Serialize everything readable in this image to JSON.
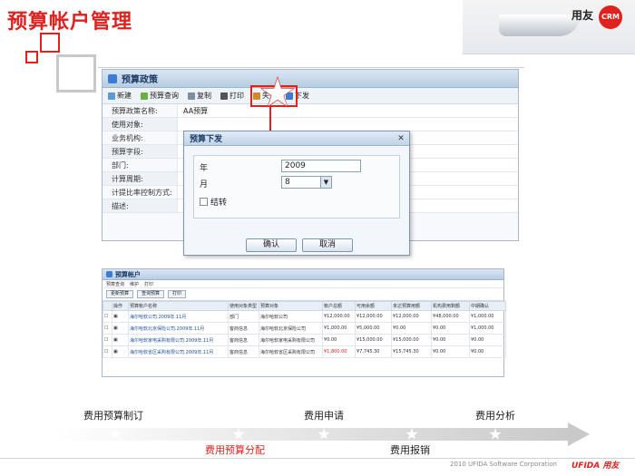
{
  "slide": {
    "title": "预算帐户管理",
    "brand_name": "用友",
    "brand_badge": "CRM",
    "copyright": "2010 UFIDA Software Corporation",
    "footer_logo": "UFIDA 用友",
    "accent_color": "#e0211d"
  },
  "main_window": {
    "title": "预算政策",
    "toolbar": [
      {
        "label": "新建",
        "icon": "new-icon"
      },
      {
        "label": "预算查询",
        "icon": "query-icon"
      },
      {
        "label": "复制",
        "icon": "copy-icon"
      },
      {
        "label": "打印",
        "icon": "print-icon"
      },
      {
        "label": "失效",
        "icon": "invalidate-icon"
      },
      {
        "label": "下发",
        "icon": "dispatch-icon"
      }
    ],
    "fields": [
      {
        "label": "预算政策名称:",
        "value": "AA预算"
      },
      {
        "label": "使用对象:",
        "value": ""
      },
      {
        "label": "业务机构:",
        "value": ""
      },
      {
        "label": "预算字段:",
        "value": ""
      },
      {
        "label": "部门:",
        "value": ""
      },
      {
        "label": "计算周期:",
        "value": ""
      },
      {
        "label": "计提比率控制方式:",
        "value": ""
      },
      {
        "label": "描述:",
        "value": ""
      }
    ]
  },
  "dialog": {
    "title": "预算下发",
    "year_label": "年",
    "year_value": "2009",
    "month_label": "月",
    "month_value": "8",
    "carryover_label": "结转",
    "ok_label": "确认",
    "cancel_label": "取消"
  },
  "second_window": {
    "title": "预算帐户",
    "menu": [
      "预算查询",
      "维护",
      "打印"
    ],
    "tools": [
      "更新预算",
      "查询预算",
      "打印"
    ],
    "columns": [
      "",
      "操作",
      "预算帐户名称",
      "使用对象类型",
      "预算对象",
      "帐户总额",
      "可用余额",
      "未达预算用额",
      "机构费用剩额",
      "中期确认"
    ],
    "rows": [
      [
        "",
        "",
        "海尔哈软公司.2009年.11月",
        "部门",
        "海尔哈软公司",
        "¥12,000.00",
        "¥12,000.00",
        "¥12,000.00",
        "¥48,000.00",
        "¥1,000.00"
      ],
      [
        "",
        "",
        "海尔哈软北京保险公司.2009年.11月",
        "客商信息",
        "海尔哈软北京保险公司",
        "¥1,000.00",
        "¥5,000.00",
        "¥0.00",
        "¥0.00",
        "¥1,000.00"
      ],
      [
        "",
        "",
        "海尔哈软家电采购有限公司.2009年.11月",
        "客商信息",
        "海尔哈软家电采购有限公司",
        "¥0.00",
        "¥15,000.00",
        "¥15,000.00",
        "¥0.00",
        "¥0.00"
      ],
      [
        "",
        "",
        "海尔哈软省区采购有限公司.2009年.11月",
        "客商信息",
        "海尔哈软省区采购有限公司",
        "¥1,800.00",
        "¥7,745.30",
        "¥15,745.30",
        "¥0.00",
        "¥0.00"
      ]
    ]
  },
  "timeline": {
    "stages_top": [
      "费用预算制订",
      "费用申请",
      "费用分析"
    ],
    "stages_bottom": [
      "费用预算分配",
      "费用报销"
    ]
  }
}
